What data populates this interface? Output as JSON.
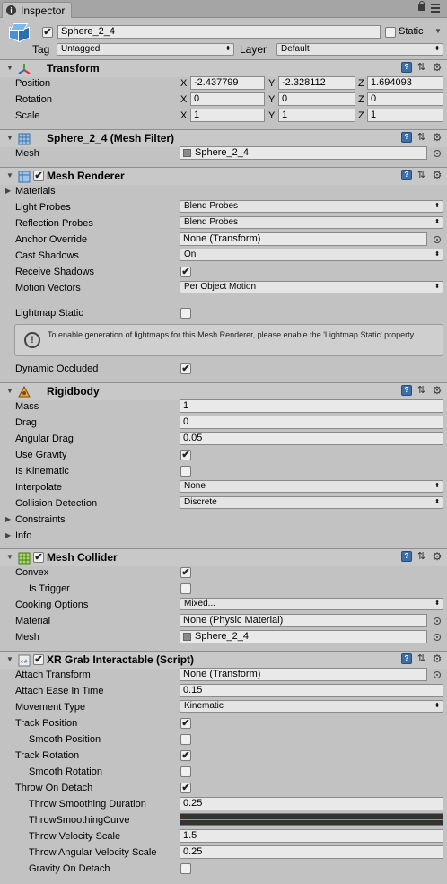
{
  "tab": {
    "title": "Inspector"
  },
  "gameobject": {
    "name": "Sphere_2_4",
    "static_label": "Static",
    "tag_label": "Tag",
    "tag_value": "Untagged",
    "layer_label": "Layer",
    "layer_value": "Default"
  },
  "transform": {
    "title": "Transform",
    "position_label": "Position",
    "rotation_label": "Rotation",
    "scale_label": "Scale",
    "position": {
      "x": "-2.437799",
      "y": "-2.328112",
      "z": "1.694093"
    },
    "rotation": {
      "x": "0",
      "y": "0",
      "z": "0"
    },
    "scale": {
      "x": "1",
      "y": "1",
      "z": "1"
    },
    "axis": {
      "x": "X",
      "y": "Y",
      "z": "Z"
    }
  },
  "mesh_filter": {
    "title": "Sphere_2_4 (Mesh Filter)",
    "mesh_label": "Mesh",
    "mesh_value": "Sphere_2_4"
  },
  "mesh_renderer": {
    "title": "Mesh Renderer",
    "materials": "Materials",
    "light_probes_label": "Light Probes",
    "light_probes": "Blend Probes",
    "reflection_probes_label": "Reflection Probes",
    "reflection_probes": "Blend Probes",
    "anchor_override_label": "Anchor Override",
    "anchor_override": "None (Transform)",
    "cast_shadows_label": "Cast Shadows",
    "cast_shadows": "On",
    "receive_shadows_label": "Receive Shadows",
    "motion_vectors_label": "Motion Vectors",
    "motion_vectors": "Per Object Motion",
    "lightmap_static_label": "Lightmap Static",
    "help_text": "To enable generation of lightmaps for this Mesh Renderer, please enable the 'Lightmap Static' property.",
    "dynamic_occluded_label": "Dynamic Occluded"
  },
  "rigidbody": {
    "title": "Rigidbody",
    "mass_label": "Mass",
    "mass": "1",
    "drag_label": "Drag",
    "drag": "0",
    "angular_drag_label": "Angular Drag",
    "angular_drag": "0.05",
    "use_gravity_label": "Use Gravity",
    "is_kinematic_label": "Is Kinematic",
    "interpolate_label": "Interpolate",
    "interpolate": "None",
    "collision_detection_label": "Collision Detection",
    "collision_detection": "Discrete",
    "constraints": "Constraints",
    "info": "Info"
  },
  "mesh_collider": {
    "title": "Mesh Collider",
    "convex_label": "Convex",
    "is_trigger_label": "Is Trigger",
    "cooking_options_label": "Cooking Options",
    "cooking_options": "Mixed...",
    "material_label": "Material",
    "material": "None (Physic Material)",
    "mesh_label": "Mesh",
    "mesh": "Sphere_2_4"
  },
  "xr_grab": {
    "title": "XR Grab Interactable (Script)",
    "attach_transform_label": "Attach Transform",
    "attach_transform": "None (Transform)",
    "attach_ease_label": "Attach Ease In Time",
    "attach_ease": "0.15",
    "movement_type_label": "Movement Type",
    "movement_type": "Kinematic",
    "track_position_label": "Track Position",
    "smooth_position_label": "Smooth Position",
    "track_rotation_label": "Track Rotation",
    "smooth_rotation_label": "Smooth Rotation",
    "throw_on_detach_label": "Throw On Detach",
    "throw_smoothing_duration_label": "Throw Smoothing Duration",
    "throw_smoothing_duration": "0.25",
    "throw_smoothing_curve_label": "ThrowSmoothingCurve",
    "throw_velocity_scale_label": "Throw Velocity Scale",
    "throw_velocity_scale": "1.5",
    "throw_angular_velocity_scale_label": "Throw Angular Velocity Scale",
    "throw_angular_velocity_scale": "0.25",
    "gravity_on_detach_label": "Gravity On Detach"
  },
  "checks": {
    "on": "✔",
    "off": ""
  },
  "icons": {
    "help": "?",
    "preset": "⇅",
    "gear": "⚙",
    "fold_open": "▼",
    "fold_closed": "▶",
    "dropdown": "⬍",
    "cs": "c#"
  },
  "colors": {
    "background": "#c2c2c2",
    "curve": "#2ed84a"
  }
}
